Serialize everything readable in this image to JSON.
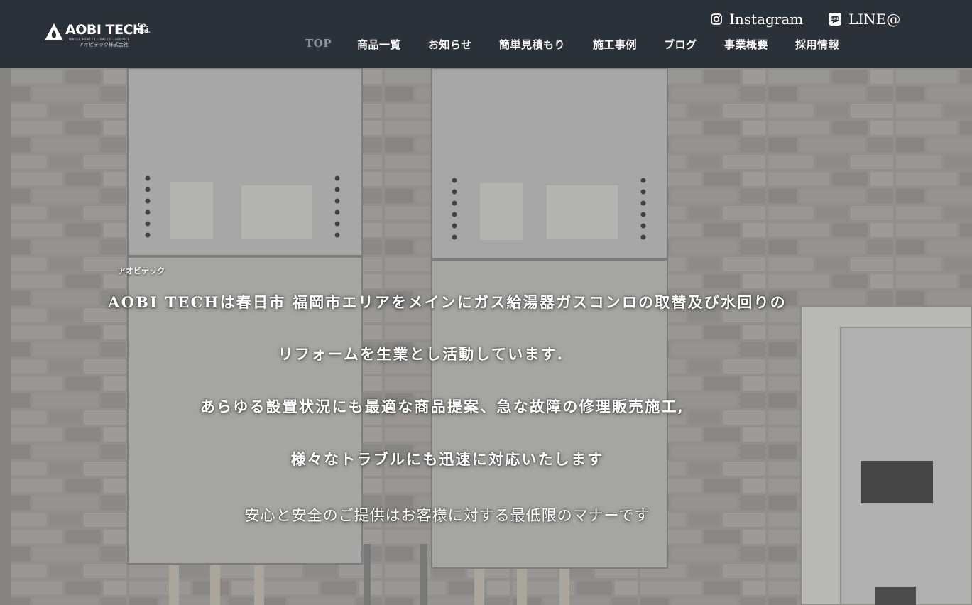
{
  "header": {
    "logo": {
      "name": "AOBI TECH",
      "suffix": "Co.\nLtd.",
      "tagline": "WATER HEATER · SALES · SERVICE",
      "sub": "アオビテック株式会社"
    },
    "social": [
      {
        "label": "Instagram",
        "icon": "instagram-icon"
      },
      {
        "label": "LINE@",
        "icon": "line-icon"
      }
    ],
    "nav": [
      {
        "label": "TOP",
        "active": true
      },
      {
        "label": "商品一覧"
      },
      {
        "label": "お知らせ"
      },
      {
        "label": "簡単見積もり"
      },
      {
        "label": "施工事例"
      },
      {
        "label": "ブログ"
      },
      {
        "label": "事業概要"
      },
      {
        "label": "採用情報"
      }
    ]
  },
  "hero": {
    "kana": "アオビテック",
    "lines": [
      "AOBI TECHは春日市 福岡市エリアをメインにガス給湯器ガスコンロの取替及び水回りの",
      "リフォームを生業とし活動しています.",
      "あらゆる設置状況にも最適な商品提案、急な故障の修理販売施工,",
      "様々なトラブルにも迅速に対応いたします",
      "安心と安全のご提供はお客様に対する最低限のマナーです"
    ]
  },
  "colors": {
    "header_bg": "#2b3139",
    "nav_active": "#8e949b",
    "text": "#ffffff"
  }
}
